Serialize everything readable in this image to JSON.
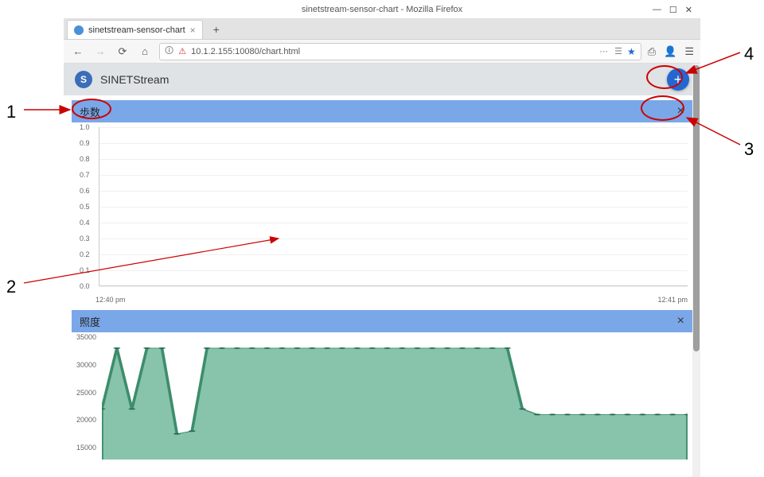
{
  "annotations": {
    "n1": "1",
    "n2": "2",
    "n3": "3",
    "n4": "4"
  },
  "window": {
    "title": "sinetstream-sensor-chart - Mozilla Firefox",
    "min": "—",
    "max": "☐",
    "close": "✕"
  },
  "tab": {
    "title": "sinetstream-sensor-chart",
    "close": "×",
    "newtab": "+"
  },
  "nav": {
    "back": "←",
    "fwd": "→",
    "reload": "⟳",
    "home": "⌂",
    "shield": "🛈",
    "lock": "⚠",
    "url": "10.1.2.155:10080/chart.html",
    "dots": "⋯",
    "reader": "☰",
    "star": "★",
    "library": "⎙",
    "account": "👤",
    "menu": "☰"
  },
  "app": {
    "title": "SINETStream",
    "add": "+"
  },
  "panel1": {
    "title": "歩数",
    "close": "×"
  },
  "panel2": {
    "title": "照度",
    "close": "×"
  },
  "chart_data": [
    {
      "type": "line",
      "title": "歩数",
      "ylim": [
        0.0,
        1.0
      ],
      "y_ticks": [
        1.0,
        0.9,
        0.8,
        0.7,
        0.6,
        0.5,
        0.4,
        0.3,
        0.2,
        0.1,
        0.0
      ],
      "x_ticks": [
        "12:40 pm",
        "12:41 pm"
      ],
      "series": [
        {
          "name": "歩数",
          "values": []
        }
      ],
      "note": "empty chart — no data rendered"
    },
    {
      "type": "area",
      "title": "照度",
      "ylim": [
        0,
        35000
      ],
      "y_ticks": [
        35000,
        30000,
        25000,
        20000,
        15000
      ],
      "x": [
        0,
        1,
        2,
        3,
        4,
        5,
        6,
        7,
        8,
        9,
        10,
        11,
        12,
        13,
        14,
        15,
        16,
        17,
        18,
        19,
        20,
        21,
        22,
        23,
        24,
        25,
        26,
        27,
        28,
        29,
        30,
        31,
        32,
        33,
        34,
        35,
        36,
        37,
        38,
        39
      ],
      "series": [
        {
          "name": "照度",
          "values": [
            22000,
            33000,
            22000,
            33000,
            33000,
            17500,
            18000,
            33000,
            33000,
            33000,
            33000,
            33000,
            33000,
            33000,
            33000,
            33000,
            33000,
            33000,
            33000,
            33000,
            33000,
            33000,
            33000,
            33000,
            33000,
            33000,
            33000,
            33000,
            22000,
            21000,
            21000,
            21000,
            21000,
            21000,
            21000,
            21000,
            21000,
            21000,
            21000,
            21000
          ]
        }
      ],
      "color": "#5fb08f"
    }
  ]
}
